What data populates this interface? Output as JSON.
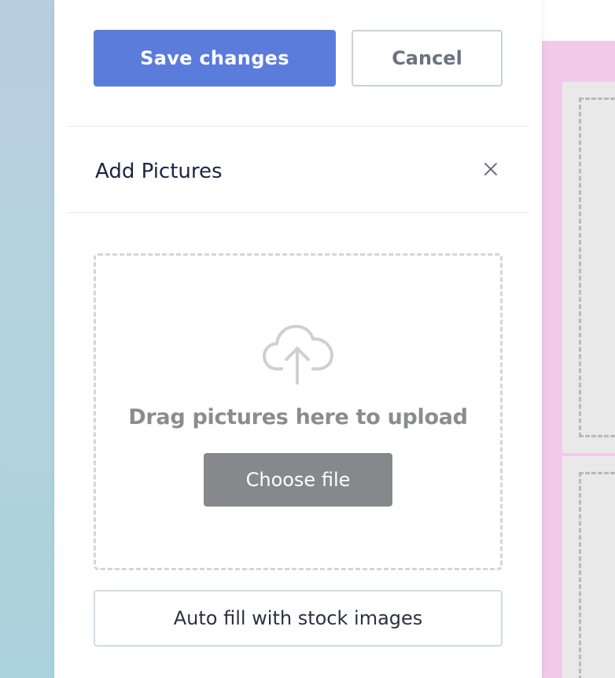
{
  "toolbar": {
    "save_label": "Save changes",
    "cancel_label": "Cancel"
  },
  "panel": {
    "title": "Add Pictures",
    "close_icon": "close-icon"
  },
  "upload": {
    "icon": "cloud-upload-icon",
    "instruction": "Drag pictures here to upload",
    "choose_label": "Choose file"
  },
  "autofill": {
    "label": "Auto fill with stock images"
  },
  "colors": {
    "primary": "#5b7cdb",
    "choose_button": "#86888b",
    "canvas_background": "#f3c9ea"
  }
}
